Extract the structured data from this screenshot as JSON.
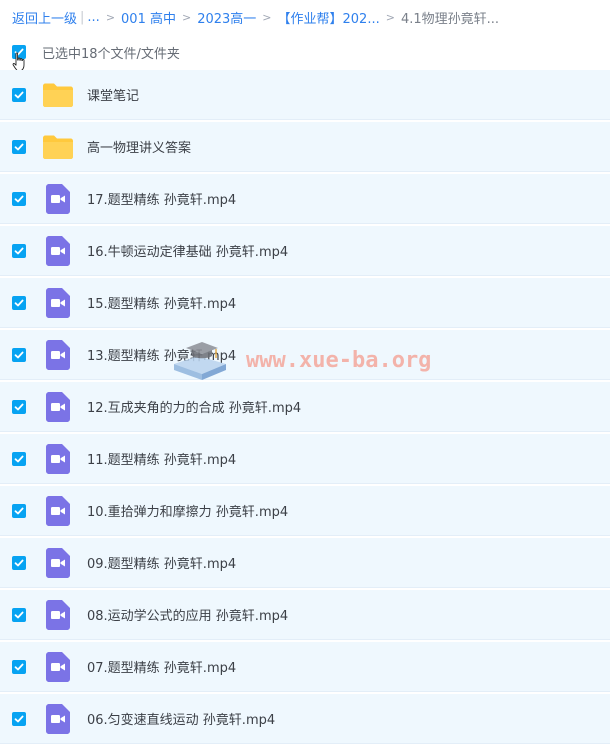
{
  "breadcrumb": {
    "back": "返回上一级",
    "ellipsis": "...",
    "crumbs": [
      "001 高中",
      "2023高一",
      "【作业帮】202..."
    ],
    "current": "4.1物理孙竟轩..."
  },
  "selection": {
    "label": "已选中18个文件/文件夹"
  },
  "colors": {
    "accent": "#07a3f2",
    "row_bg": "#eff8fe",
    "folder": "#ffc93d",
    "video": "#7b73e6"
  },
  "files": [
    {
      "name": "课堂笔记",
      "type": "folder"
    },
    {
      "name": "高一物理讲义答案",
      "type": "folder"
    },
    {
      "name": "17.题型精练 孙竟轩.mp4",
      "type": "video"
    },
    {
      "name": "16.牛顿运动定律基础 孙竟轩.mp4",
      "type": "video"
    },
    {
      "name": "15.题型精练 孙竟轩.mp4",
      "type": "video"
    },
    {
      "name": "13.题型精练 孙竟轩.mp4",
      "type": "video"
    },
    {
      "name": "12.互成夹角的力的合成 孙竟轩.mp4",
      "type": "video"
    },
    {
      "name": "11.题型精练 孙竟轩.mp4",
      "type": "video"
    },
    {
      "name": "10.重拾弹力和摩擦力 孙竟轩.mp4",
      "type": "video"
    },
    {
      "name": "09.题型精练 孙竟轩.mp4",
      "type": "video"
    },
    {
      "name": "08.运动学公式的应用 孙竟轩.mp4",
      "type": "video"
    },
    {
      "name": "07.题型精练 孙竟轩.mp4",
      "type": "video"
    },
    {
      "name": "06.匀变速直线运动 孙竟轩.mp4",
      "type": "video"
    }
  ],
  "watermark": {
    "text": "www.xue-ba.org"
  }
}
